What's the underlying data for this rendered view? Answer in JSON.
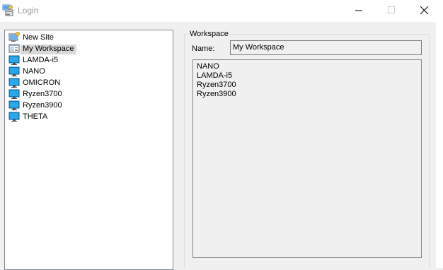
{
  "window": {
    "title": "Login",
    "app_icon": "login-icon",
    "controls": {
      "minimize": "minimize-icon",
      "maximize": "maximize-icon",
      "close": "close-icon"
    }
  },
  "tree": {
    "items": [
      {
        "label": "New Site",
        "icon": "new-site-icon",
        "selected": false
      },
      {
        "label": "My Workspace",
        "icon": "workspace-icon",
        "selected": true
      },
      {
        "label": "LAMDA-i5",
        "icon": "computer-icon",
        "selected": false
      },
      {
        "label": "NANO",
        "icon": "computer-icon",
        "selected": false
      },
      {
        "label": "OMICRON",
        "icon": "computer-icon",
        "selected": false
      },
      {
        "label": "Ryzen3700",
        "icon": "computer-icon",
        "selected": false
      },
      {
        "label": "Ryzen3900",
        "icon": "computer-icon",
        "selected": false
      },
      {
        "label": "THETA",
        "icon": "computer-icon",
        "selected": false
      }
    ]
  },
  "workspace": {
    "group_title": "Workspace",
    "name_label": "Name:",
    "name_value": "My Workspace",
    "sites": [
      "NANO",
      "LAMDA-i5",
      "Ryzen3700",
      "Ryzen3900"
    ]
  },
  "colors": {
    "selection": "#d9d9d9",
    "monitor": "#1e90d6",
    "background": "#f0f0f0"
  }
}
